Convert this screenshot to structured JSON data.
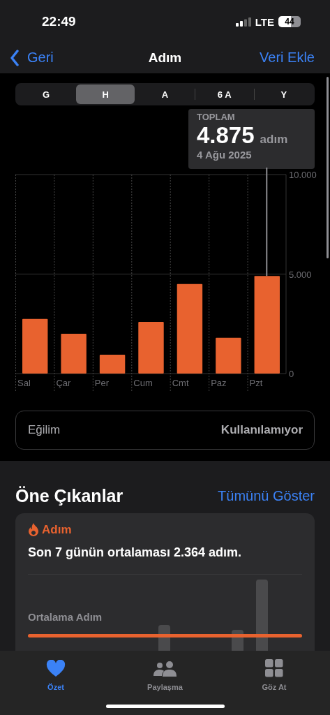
{
  "status_bar": {
    "time": "22:49",
    "network": "LTE",
    "battery": "44"
  },
  "nav": {
    "back": "Geri",
    "title": "Adım",
    "action": "Veri Ekle"
  },
  "segments": [
    {
      "label": "G",
      "selected": false
    },
    {
      "label": "H",
      "selected": true
    },
    {
      "label": "A",
      "selected": false
    },
    {
      "label": "6 A",
      "selected": false
    },
    {
      "label": "Y",
      "selected": false
    }
  ],
  "total": {
    "label": "TOPLAM",
    "value": "4.875",
    "unit": "adım",
    "date": "4 Ağu 2025"
  },
  "chart_data": {
    "type": "bar",
    "categories": [
      "Sal",
      "Çar",
      "Per",
      "Cum",
      "Cmt",
      "Paz",
      "Pzt"
    ],
    "series": [
      {
        "color": "#e8622f",
        "values": [
          2750,
          2000,
          950,
          2600,
          4500,
          1800,
          4900
        ]
      }
    ],
    "ylim": [
      0,
      10000
    ],
    "yticks": [
      {
        "value": 0,
        "label": "0"
      },
      {
        "value": 5000,
        "label": "5.000"
      },
      {
        "value": 10000,
        "label": "10.000"
      }
    ]
  },
  "trend": {
    "label": "Eğilim",
    "value": "Kullanılamıyor"
  },
  "highlights": {
    "title": "Öne Çıkanlar",
    "link": "Tümünü Göster",
    "card": {
      "category": "Adım",
      "text": "Son 7 günün ortalaması 2.364 adım.",
      "chart_label": "Ortalama Adım"
    }
  },
  "tab_bar": [
    {
      "label": "Özet",
      "kind": "heart",
      "selected": true
    },
    {
      "label": "Paylaşma",
      "kind": "people",
      "selected": false
    },
    {
      "label": "Göz At",
      "kind": "grid",
      "selected": false
    }
  ]
}
